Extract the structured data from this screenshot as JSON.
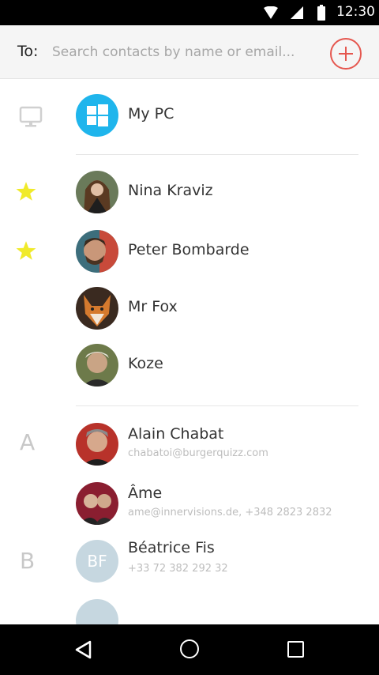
{
  "status_bar": {
    "time": "12:30"
  },
  "to_bar": {
    "label": "To:",
    "placeholder": "Search contacts by name or email..."
  },
  "devices": [
    {
      "name": "My PC"
    }
  ],
  "favorites": [
    {
      "name": "Nina Kraviz",
      "starred": true
    },
    {
      "name": "Peter Bombarde",
      "starred": true
    },
    {
      "name": "Mr Fox",
      "starred": false
    },
    {
      "name": "Koze",
      "starred": false
    }
  ],
  "sections": [
    {
      "letter": "A",
      "contacts": [
        {
          "name": "Alain Chabat",
          "detail": "chabatoi@burgerquizz.com"
        },
        {
          "name": "Âme",
          "detail": "ame@innervisions.de, +348 2823 2832"
        }
      ]
    },
    {
      "letter": "B",
      "contacts": [
        {
          "name": "Béatrice Fis",
          "detail": "+33 72 382 292 32",
          "initials": "BF"
        }
      ]
    }
  ],
  "colors": {
    "accent": "#e5574f",
    "star": "#f0ea2a",
    "windows_blue": "#1fb5ec",
    "placeholder_avatar": "#c6d7e0"
  }
}
